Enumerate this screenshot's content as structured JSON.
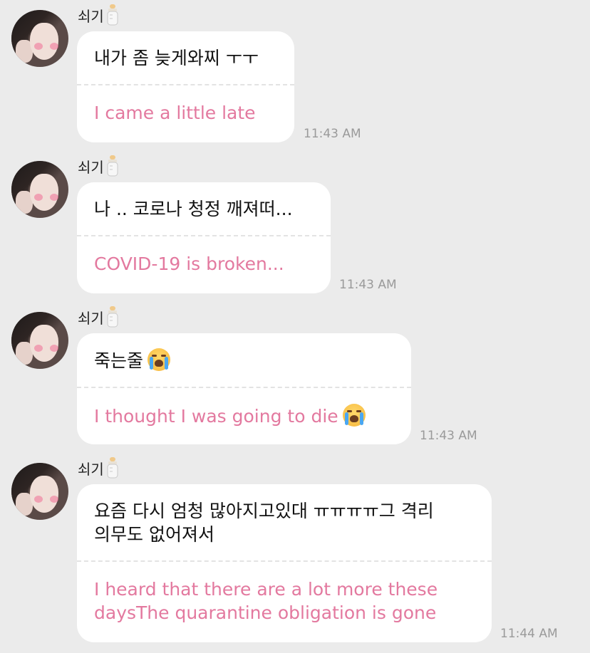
{
  "sender_name": "쇠기",
  "sender_icon": "baby-bottle-icon",
  "messages": [
    {
      "korean": "내가 좀 늦게와찌 ㅜㅜ",
      "english": "I came a little late",
      "time": "11:43 AM"
    },
    {
      "korean": "나 .. 코로나 청정 깨져떠...",
      "english": "COVID-19 is broken...",
      "time": "11:43 AM"
    },
    {
      "korean": "죽는줄",
      "korean_emoji": "loudly-crying-face-icon",
      "english": "I thought I was going to die",
      "english_emoji": "loudly-crying-face-icon",
      "time": "11:43 AM"
    },
    {
      "korean": "요즘 다시 엄청 많아지고있대 ㅠㅠㅠㅠ그 격리\n의무도 없어져서",
      "english": "I heard that there are a lot more these\ndaysThe quarantine obligation is gone",
      "time": "11:44 AM"
    }
  ],
  "colors": {
    "background": "#ebebeb",
    "bubble": "#ffffff",
    "translation_text": "#e3799f",
    "timestamp": "#9a9a9a"
  }
}
